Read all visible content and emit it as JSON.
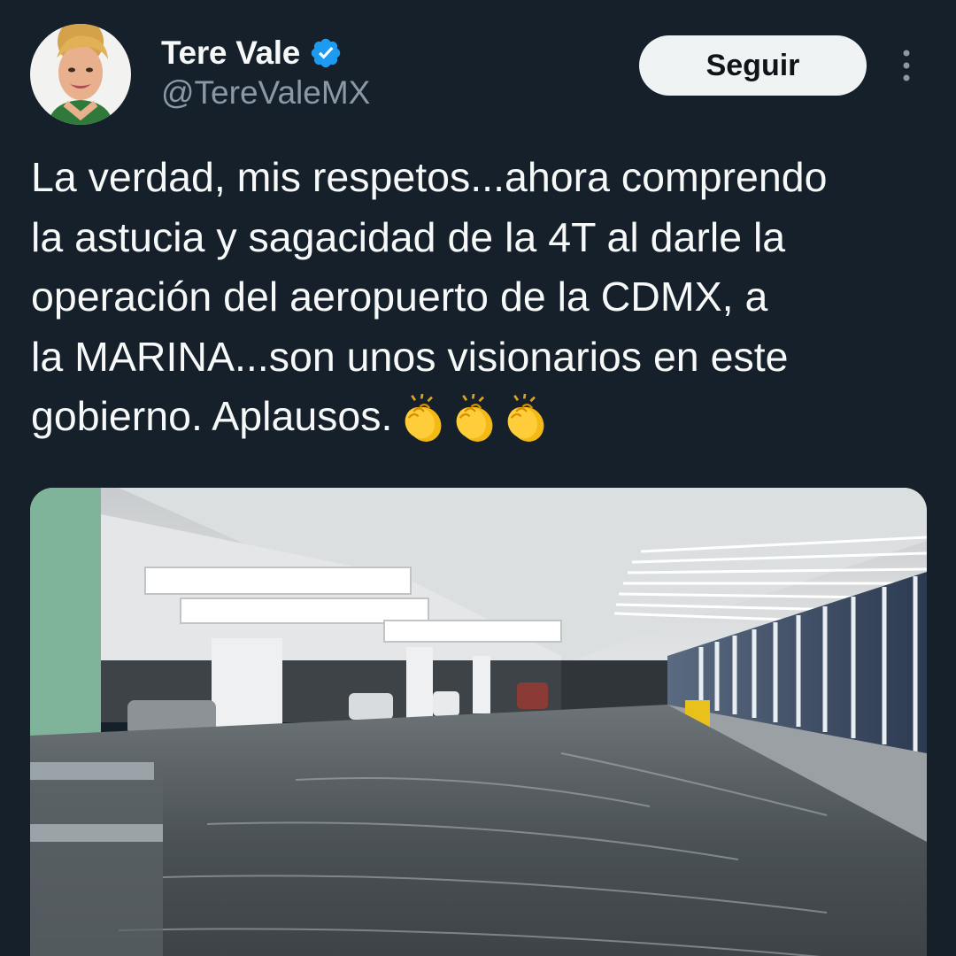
{
  "author": {
    "display_name": "Tere Vale",
    "handle": "@TereValeMX",
    "verified": true,
    "verified_color": "#1d9bf0"
  },
  "actions": {
    "follow_label": "Seguir",
    "more_icon": "more-vertical-icon"
  },
  "tweet": {
    "lines": [
      "La verdad, mis respetos...ahora comprendo",
      "la astucia y sagacidad de la 4T al darle la",
      "operación del aeropuerto de la CDMX, a",
      "la MARINA...son unos visionarios en este",
      "gobierno. Aplausos."
    ],
    "emojis": [
      "clapping-hands-emoji",
      "clapping-hands-emoji",
      "clapping-hands-emoji"
    ]
  },
  "media": {
    "type": "photo",
    "subject": "flooded-airport-terminal-photo"
  },
  "colors": {
    "background": "#15202b",
    "text_primary": "#f7f9f9",
    "text_secondary": "#8b98a5",
    "button_bg": "#eff3f4"
  }
}
